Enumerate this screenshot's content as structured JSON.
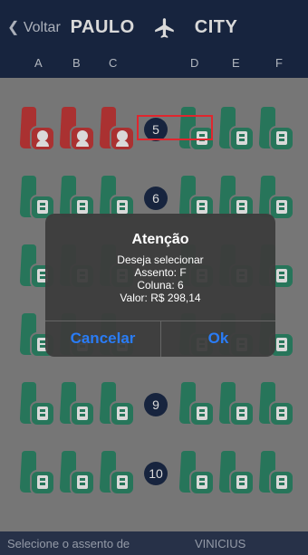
{
  "header": {
    "back_label": "Voltar",
    "origin": "PAULO",
    "destination": "CITY",
    "plane_icon": "plane-icon"
  },
  "columns": [
    "A",
    "B",
    "C",
    "D",
    "E",
    "F"
  ],
  "rows": [
    {
      "number": "5",
      "occupied_left": true
    },
    {
      "number": "6",
      "occupied_left": false
    },
    {
      "number": "",
      "occupied_left": false
    },
    {
      "number": "",
      "occupied_left": false
    },
    {
      "number": "9",
      "occupied_left": false
    },
    {
      "number": "10",
      "occupied_left": false
    }
  ],
  "colors": {
    "occupied": "#c83a3a",
    "available": "#2e8a6a",
    "header": "#1c2b49"
  },
  "footer": {
    "prompt": "Selecione o assento de",
    "passenger": "VINICIUS"
  },
  "dialog": {
    "title": "Atenção",
    "line1": "Deseja selecionar",
    "line2": "Assento: F",
    "line3": "Coluna: 6",
    "line4": "Valor: R$ 298,14",
    "cancel_label": "Cancelar",
    "ok_label": "Ok"
  }
}
